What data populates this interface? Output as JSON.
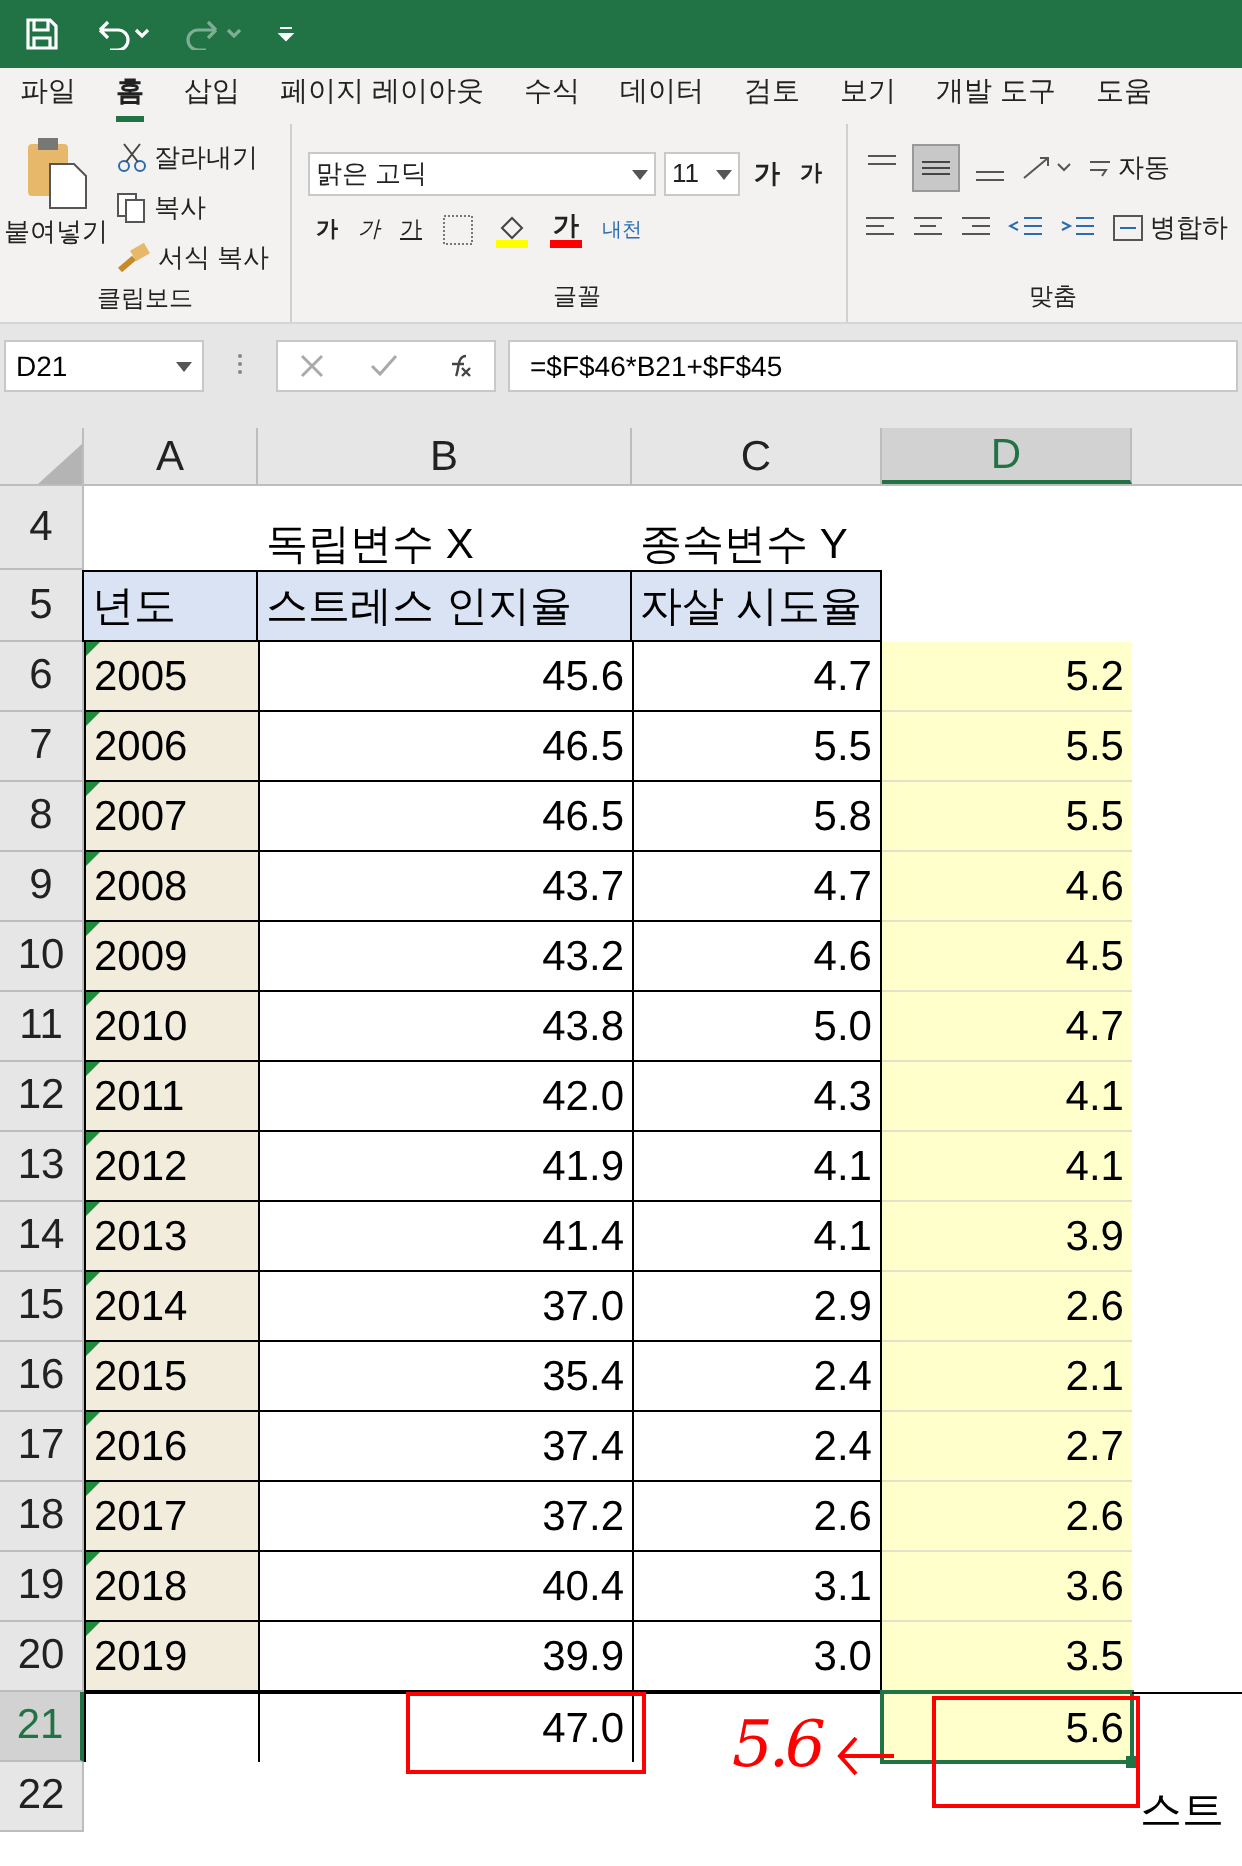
{
  "tabs": [
    {
      "label": "파일",
      "selected": false
    },
    {
      "label": "홈",
      "selected": true
    },
    {
      "label": "삽입",
      "selected": false
    },
    {
      "label": "페이지 레이아웃",
      "selected": false
    },
    {
      "label": "수식",
      "selected": false
    },
    {
      "label": "데이터",
      "selected": false
    },
    {
      "label": "검토",
      "selected": false
    },
    {
      "label": "보기",
      "selected": false
    },
    {
      "label": "개발 도구",
      "selected": false
    },
    {
      "label": "도움",
      "selected": false
    }
  ],
  "ribbon": {
    "clipboard": {
      "paste": "붙여넣기",
      "cut": "잘라내기",
      "copy": "복사",
      "format_painter": "서식 복사",
      "group": "클립보드"
    },
    "font": {
      "name": "맑은 고딕",
      "size": "11",
      "grow": "가",
      "shrink": "가",
      "bold": "가",
      "italic": "가",
      "underline": "가",
      "font_color": "가",
      "phonetic": "내천",
      "group": "글꼴"
    },
    "alignment": {
      "wrap": "자동",
      "merge": "병합하",
      "group": "맞춤"
    }
  },
  "formula_bar": {
    "name_box": "D21",
    "formula": "=$F$46*B21+$F$45"
  },
  "columns": [
    {
      "label": "A",
      "selected": false
    },
    {
      "label": "B",
      "selected": false
    },
    {
      "label": "C",
      "selected": false
    },
    {
      "label": "D",
      "selected": true
    }
  ],
  "rows": [
    {
      "number": "4",
      "kind": "title",
      "selected": false,
      "cells": [
        "",
        "독립변수 X",
        "종속변수 Y",
        ""
      ]
    },
    {
      "number": "5",
      "kind": "header",
      "selected": false,
      "cells": [
        "년도",
        "스트레스 인지율",
        "자살 시도율",
        ""
      ]
    },
    {
      "number": "6",
      "kind": "data",
      "selected": false,
      "cells": [
        "2005",
        "45.6",
        "4.7",
        "5.2"
      ]
    },
    {
      "number": "7",
      "kind": "data",
      "selected": false,
      "cells": [
        "2006",
        "46.5",
        "5.5",
        "5.5"
      ]
    },
    {
      "number": "8",
      "kind": "data",
      "selected": false,
      "cells": [
        "2007",
        "46.5",
        "5.8",
        "5.5"
      ]
    },
    {
      "number": "9",
      "kind": "data",
      "selected": false,
      "cells": [
        "2008",
        "43.7",
        "4.7",
        "4.6"
      ]
    },
    {
      "number": "10",
      "kind": "data",
      "selected": false,
      "cells": [
        "2009",
        "43.2",
        "4.6",
        "4.5"
      ]
    },
    {
      "number": "11",
      "kind": "data",
      "selected": false,
      "cells": [
        "2010",
        "43.8",
        "5.0",
        "4.7"
      ]
    },
    {
      "number": "12",
      "kind": "data",
      "selected": false,
      "cells": [
        "2011",
        "42.0",
        "4.3",
        "4.1"
      ]
    },
    {
      "number": "13",
      "kind": "data",
      "selected": false,
      "cells": [
        "2012",
        "41.9",
        "4.1",
        "4.1"
      ]
    },
    {
      "number": "14",
      "kind": "data",
      "selected": false,
      "cells": [
        "2013",
        "41.4",
        "4.1",
        "3.9"
      ]
    },
    {
      "number": "15",
      "kind": "data",
      "selected": false,
      "cells": [
        "2014",
        "37.0",
        "2.9",
        "2.6"
      ]
    },
    {
      "number": "16",
      "kind": "data",
      "selected": false,
      "cells": [
        "2015",
        "35.4",
        "2.4",
        "2.1"
      ]
    },
    {
      "number": "17",
      "kind": "data",
      "selected": false,
      "cells": [
        "2016",
        "37.4",
        "2.4",
        "2.7"
      ]
    },
    {
      "number": "18",
      "kind": "data",
      "selected": false,
      "cells": [
        "2017",
        "37.2",
        "2.6",
        "2.6"
      ]
    },
    {
      "number": "19",
      "kind": "data",
      "selected": false,
      "cells": [
        "2018",
        "40.4",
        "3.1",
        "3.6"
      ]
    },
    {
      "number": "20",
      "kind": "data",
      "selected": false,
      "cells": [
        "2019",
        "39.9",
        "3.0",
        "3.5"
      ]
    },
    {
      "number": "21",
      "kind": "input",
      "selected": true,
      "cells": [
        "",
        "47.0",
        "",
        "5.6"
      ]
    },
    {
      "number": "22",
      "kind": "blank",
      "selected": false,
      "cells": [
        "",
        "",
        "",
        ""
      ],
      "column_e": "스트"
    }
  ],
  "annotations": [
    {
      "kind": "box"
    },
    {
      "kind": "box"
    },
    {
      "kind": "handwriting",
      "text": "5.6"
    }
  ]
}
